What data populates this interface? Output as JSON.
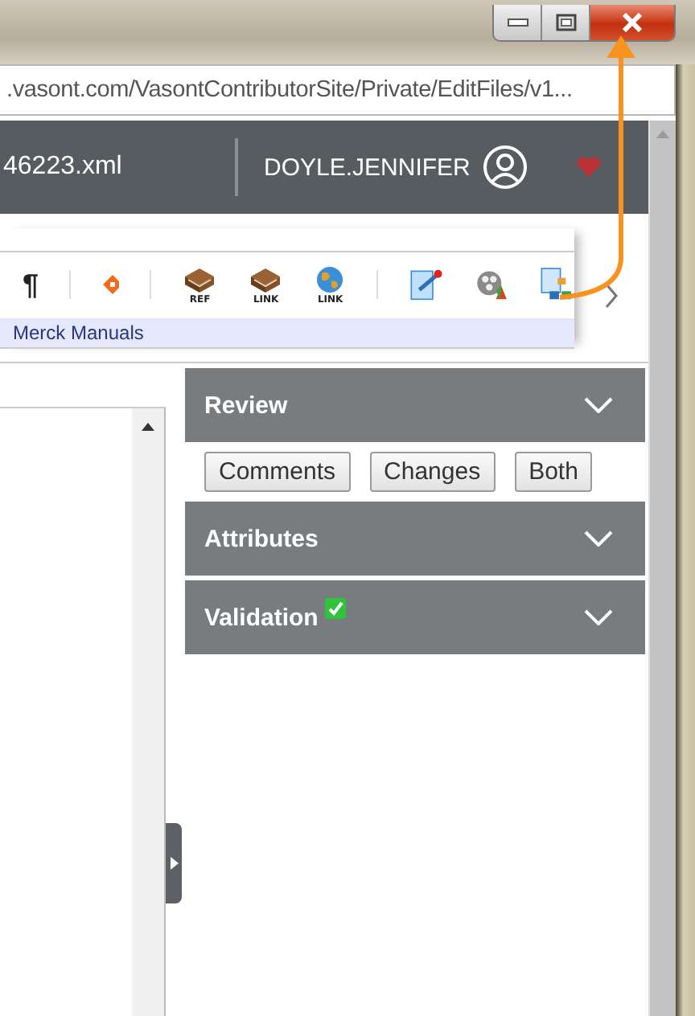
{
  "address_bar": {
    "url": ".vasont.com/VasontContributorSite/Private/EditFiles/v1..."
  },
  "header": {
    "file_name": "46223.xml",
    "user": "DOYLE.JENNIFER"
  },
  "toolbar": [
    {
      "kind": "glyph",
      "text": "¶"
    },
    {
      "kind": "separator"
    },
    {
      "kind": "diamond"
    },
    {
      "kind": "separator"
    },
    {
      "kind": "book",
      "label": "REF"
    },
    {
      "kind": "book",
      "label": "LINK"
    },
    {
      "kind": "globe",
      "label": "LINK"
    },
    {
      "kind": "separator"
    },
    {
      "kind": "edit"
    },
    {
      "kind": "film"
    },
    {
      "kind": "diagram"
    }
  ],
  "toolbar_strip": {
    "label": "Merck Manuals"
  },
  "panel": [
    {
      "title": "Review",
      "buttons": [
        "Comments",
        "Changes",
        "Both"
      ]
    },
    {
      "title": "Attributes"
    },
    {
      "title": "Validation",
      "valid": true
    }
  ]
}
